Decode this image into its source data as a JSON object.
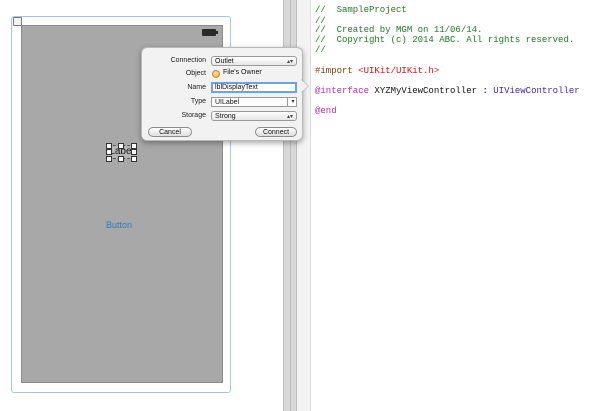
{
  "canvas": {
    "label_text": "Label",
    "button_text": "Button"
  },
  "connection_popover": {
    "connection": {
      "label": "Connection",
      "value": "Outlet"
    },
    "object": {
      "label": "Object",
      "value": "File's Owner",
      "icon": "files-owner-icon"
    },
    "name": {
      "label": "Name",
      "value": "lblDisplayText"
    },
    "type": {
      "label": "Type",
      "value": "UILabel"
    },
    "storage": {
      "label": "Storage",
      "value": "Strong"
    },
    "cancel_label": "Cancel",
    "connect_label": "Connect"
  },
  "code_editor": {
    "lines": [
      "//  SampleProject",
      "//",
      "//  Created by MGM on 11/06/14.",
      "//  Copyright (c) 2014 ABC. All rights reserved.",
      "//",
      "#import",
      "<UIKit/UIKit.h>",
      "@interface",
      "XYZMyViewController",
      ":",
      "UIViewController",
      "@end"
    ]
  },
  "colors": {
    "comment": "#1c7a24",
    "keyword": "#a23ba0",
    "string": "#c41a16",
    "button_text": "#1e7fcf",
    "name_focus": "#6fa2e0"
  }
}
